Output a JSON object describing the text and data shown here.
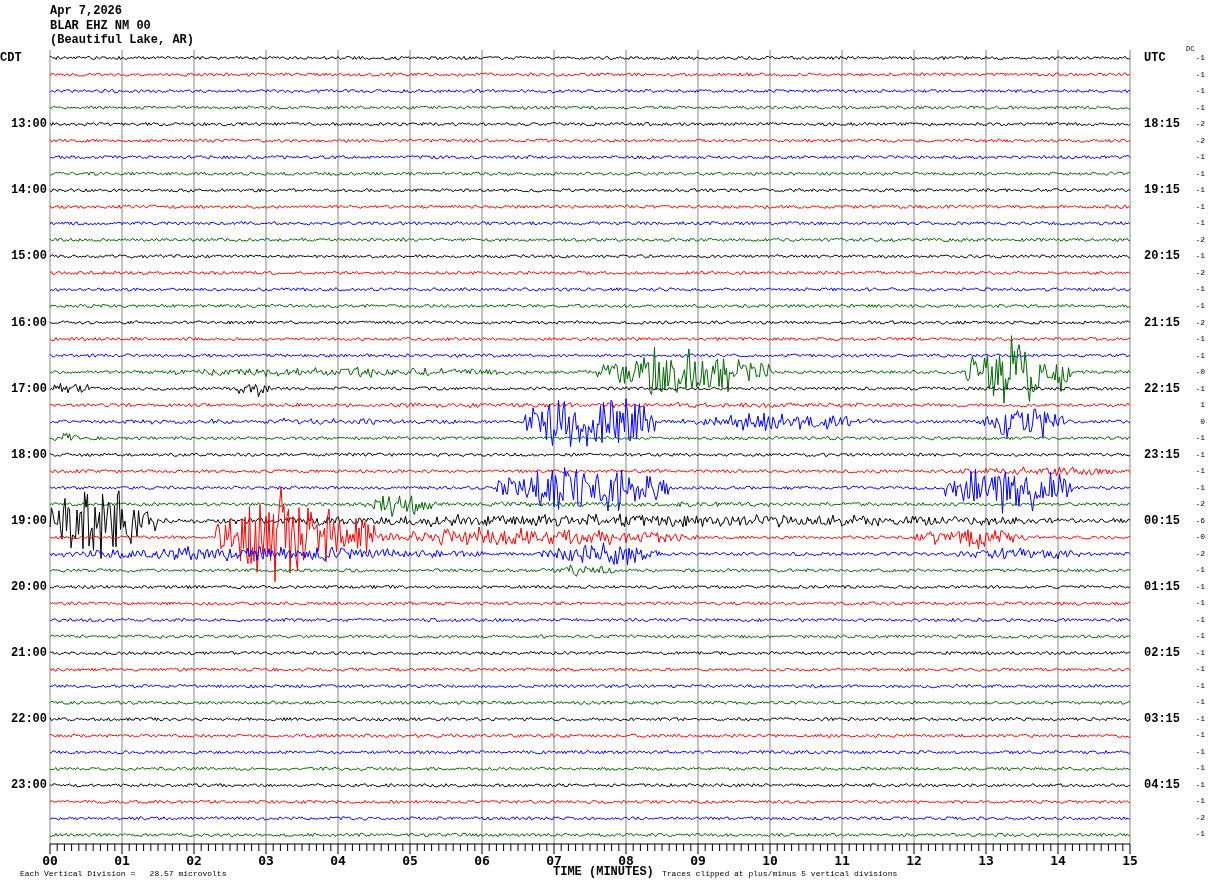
{
  "header": {
    "date": "Apr 7,2026",
    "station": "BLAR EHZ NM 00",
    "location": "(Beautiful Lake, AR)"
  },
  "left_heading": "CDT",
  "right_heading": "UTC",
  "dc_heading": "DC",
  "rows": [
    {
      "color": "#000000",
      "dc": "-1"
    },
    {
      "color": "#ff0000",
      "dc": "-1"
    },
    {
      "color": "#0000ff",
      "dc": "-1"
    },
    {
      "color": "#006600",
      "dc": "-1"
    },
    {
      "color": "#000000",
      "dc": "-2",
      "cdt": "13:00",
      "utc": "18:15"
    },
    {
      "color": "#ff0000",
      "dc": "-2"
    },
    {
      "color": "#0000ff",
      "dc": "-1"
    },
    {
      "color": "#006600",
      "dc": "-1"
    },
    {
      "color": "#000000",
      "dc": "-1",
      "cdt": "14:00",
      "utc": "19:15"
    },
    {
      "color": "#ff0000",
      "dc": "-1"
    },
    {
      "color": "#0000ff",
      "dc": "-1"
    },
    {
      "color": "#006600",
      "dc": "-2"
    },
    {
      "color": "#000000",
      "dc": "-1",
      "cdt": "15:00",
      "utc": "20:15"
    },
    {
      "color": "#ff0000",
      "dc": "-2"
    },
    {
      "color": "#0000ff",
      "dc": "-1"
    },
    {
      "color": "#006600",
      "dc": "-1"
    },
    {
      "color": "#000000",
      "dc": "-2",
      "cdt": "16:00",
      "utc": "21:15"
    },
    {
      "color": "#ff0000",
      "dc": "-1"
    },
    {
      "color": "#0000ff",
      "dc": "-1"
    },
    {
      "color": "#006600",
      "dc": "-0"
    },
    {
      "color": "#000000",
      "dc": "-1",
      "cdt": "17:00",
      "utc": "22:15"
    },
    {
      "color": "#ff0000",
      "dc": "1"
    },
    {
      "color": "#0000ff",
      "dc": "0"
    },
    {
      "color": "#006600",
      "dc": "-1"
    },
    {
      "color": "#000000",
      "dc": "-1",
      "cdt": "18:00",
      "utc": "23:15"
    },
    {
      "color": "#ff0000",
      "dc": "-1"
    },
    {
      "color": "#0000ff",
      "dc": "-1"
    },
    {
      "color": "#006600",
      "dc": "-2"
    },
    {
      "color": "#000000",
      "dc": "-6",
      "cdt": "19:00",
      "utc": "00:15"
    },
    {
      "color": "#ff0000",
      "dc": "-0"
    },
    {
      "color": "#0000ff",
      "dc": "-2"
    },
    {
      "color": "#006600",
      "dc": "-1"
    },
    {
      "color": "#000000",
      "dc": "-1",
      "cdt": "20:00",
      "utc": "01:15"
    },
    {
      "color": "#ff0000",
      "dc": "-1"
    },
    {
      "color": "#0000ff",
      "dc": "-1"
    },
    {
      "color": "#006600",
      "dc": "-1"
    },
    {
      "color": "#000000",
      "dc": "-1",
      "cdt": "21:00",
      "utc": "02:15"
    },
    {
      "color": "#ff0000",
      "dc": "-1"
    },
    {
      "color": "#0000ff",
      "dc": "-1"
    },
    {
      "color": "#006600",
      "dc": "-1"
    },
    {
      "color": "#000000",
      "dc": "-1",
      "cdt": "22:00",
      "utc": "03:15"
    },
    {
      "color": "#ff0000",
      "dc": "-1"
    },
    {
      "color": "#0000ff",
      "dc": "-1"
    },
    {
      "color": "#006600",
      "dc": "-1"
    },
    {
      "color": "#000000",
      "dc": "-1",
      "cdt": "23:00",
      "utc": "04:15"
    },
    {
      "color": "#ff0000",
      "dc": "-1"
    },
    {
      "color": "#0000ff",
      "dc": "-2"
    },
    {
      "color": "#006600",
      "dc": "-1"
    }
  ],
  "x_axis": {
    "ticks": [
      "00",
      "01",
      "02",
      "03",
      "04",
      "05",
      "06",
      "07",
      "08",
      "09",
      "10",
      "11",
      "12",
      "13",
      "14",
      "15"
    ],
    "title": "TIME (MINUTES)"
  },
  "footer": {
    "scale_note": "Each Vertical Division =   28.57 microvolts",
    "clip_note": "Traces clipped at plus/minus 5 vertical divisions"
  }
}
